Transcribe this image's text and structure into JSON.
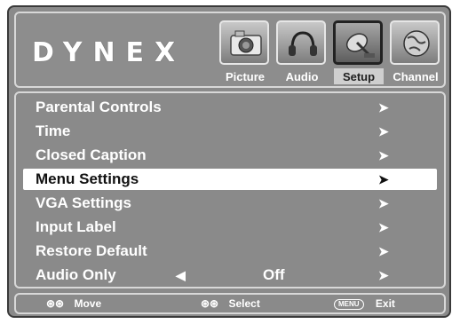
{
  "brand": {
    "logo": "DYNEX"
  },
  "tabs": [
    {
      "label": "Picture",
      "icon": "camera-icon",
      "active": false
    },
    {
      "label": "Audio",
      "icon": "headphones-icon",
      "active": false
    },
    {
      "label": "Setup",
      "icon": "satellite-dish-icon",
      "active": true
    },
    {
      "label": "Channel",
      "icon": "globe-icon",
      "active": false
    }
  ],
  "menu": {
    "items": [
      {
        "label": "Parental Controls",
        "arrow": "➤"
      },
      {
        "label": "Time",
        "arrow": "➤"
      },
      {
        "label": "Closed Caption",
        "arrow": "➤"
      },
      {
        "label": "Menu Settings",
        "arrow": "➤",
        "selected": true
      },
      {
        "label": "VGA Settings",
        "arrow": "➤"
      },
      {
        "label": "Input Label",
        "arrow": "➤"
      },
      {
        "label": "Restore Default",
        "arrow": "➤"
      },
      {
        "label": "Audio Only",
        "left_arrow": "◀",
        "value": "Off",
        "arrow": "➤"
      }
    ]
  },
  "footer": {
    "move": {
      "keys": "⊛⊛",
      "label": "Move"
    },
    "select": {
      "keys": "⊛⊛",
      "label": "Select"
    },
    "exit": {
      "key": "MENU",
      "label": "Exit"
    }
  },
  "colors": {
    "panel": "#8a8a8a",
    "highlight": "#ffffff",
    "text": "#ffffff"
  }
}
